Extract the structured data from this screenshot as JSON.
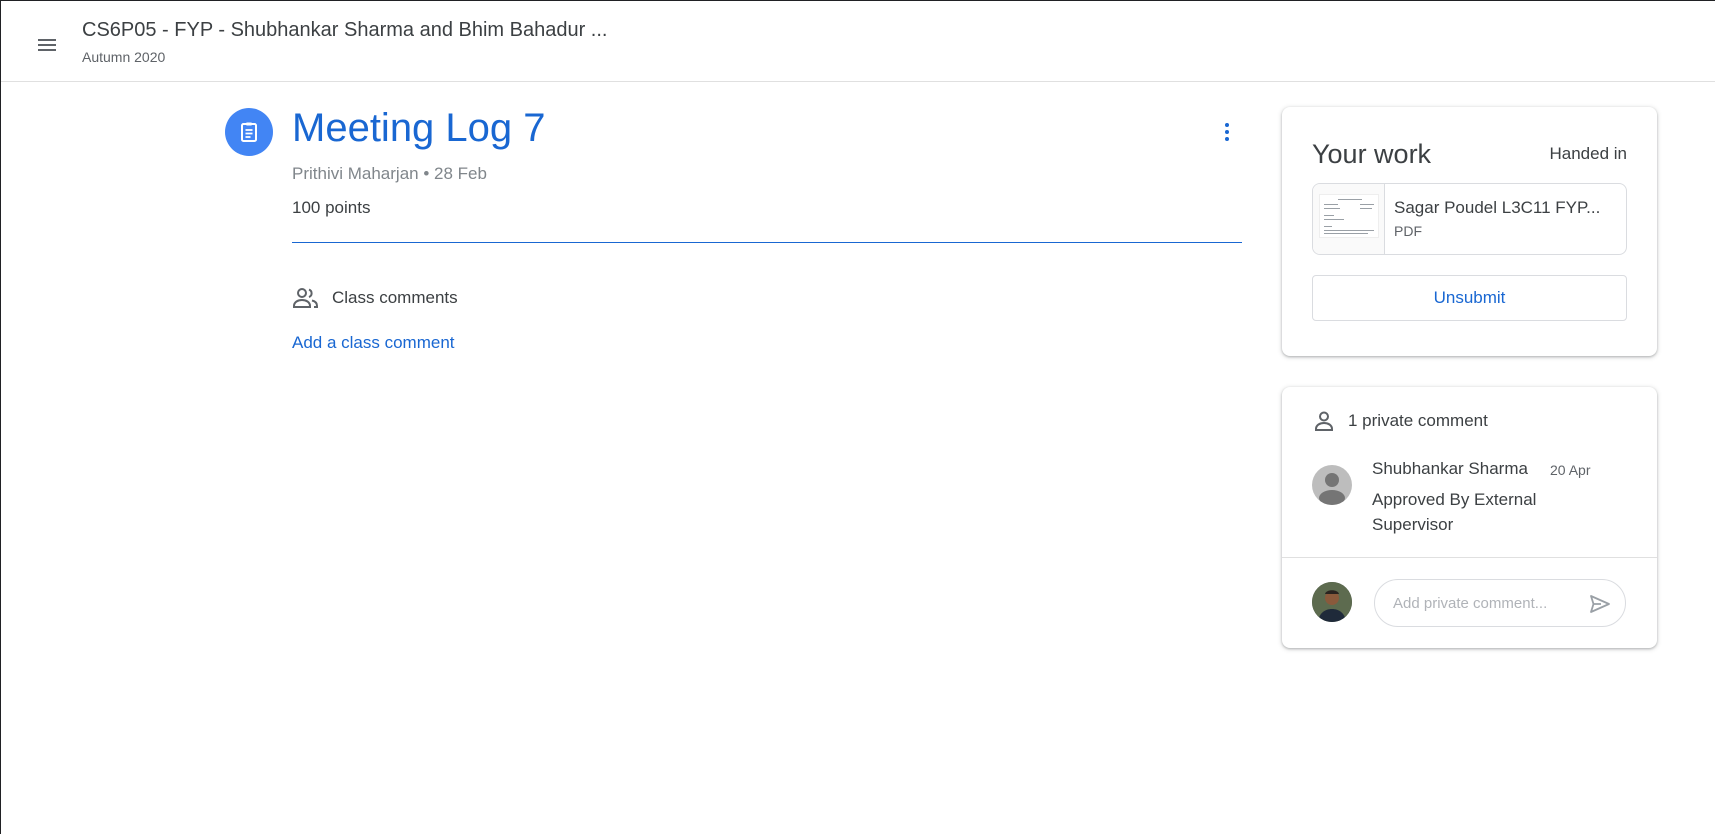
{
  "header": {
    "course_title": "CS6P05 - FYP - Shubhankar Sharma and Bhim Bahadur ...",
    "course_term": "Autumn 2020",
    "menu_icon": "hamburger-menu-icon"
  },
  "assignment": {
    "icon": "assignment-icon",
    "title": "Meeting Log 7",
    "meta": "Prithivi Maharjan • 28 Feb",
    "points": "100 points",
    "accent_color": "#1967d2"
  },
  "class_comments": {
    "label": "Class comments",
    "add_link": "Add a class comment"
  },
  "your_work": {
    "title": "Your work",
    "status": "Handed in",
    "attachment": {
      "name": "Sagar Poudel L3C11 FYP...",
      "type": "PDF"
    },
    "unsubmit_label": "Unsubmit"
  },
  "private_comments": {
    "count_label": "1 private comment",
    "comments": [
      {
        "author": "Shubhankar Sharma",
        "date": "20 Apr",
        "text": "Approved By External Supervisor"
      }
    ],
    "input_placeholder": "Add private comment..."
  }
}
